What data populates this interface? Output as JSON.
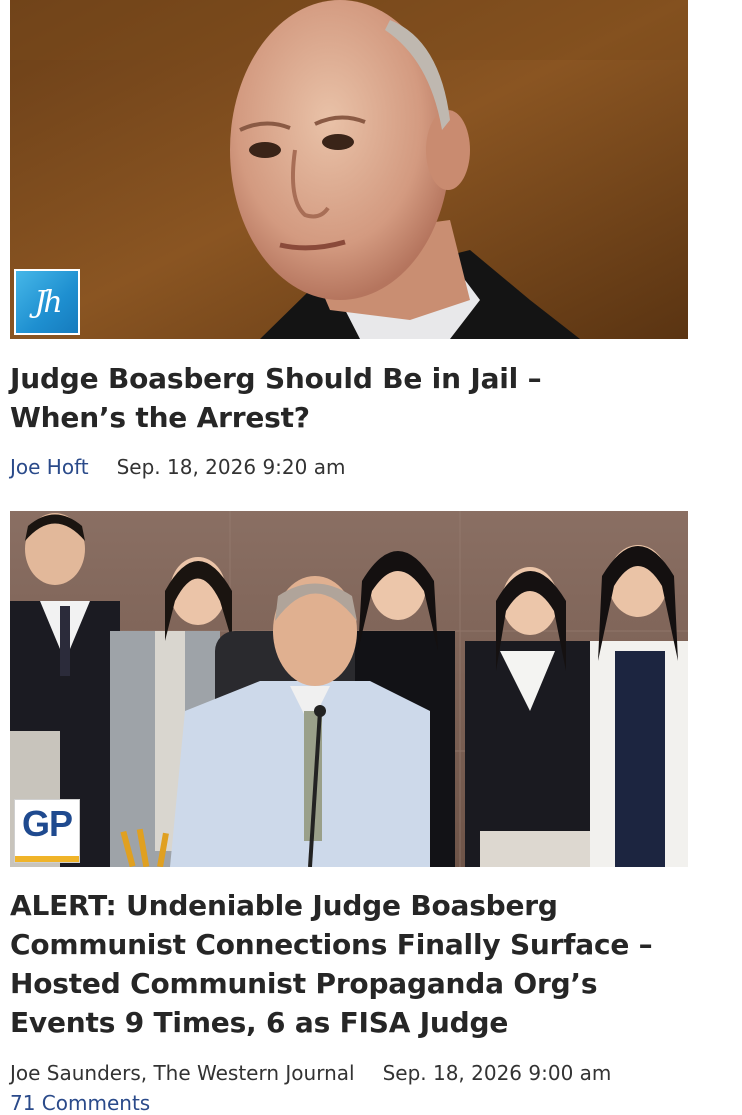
{
  "articles": [
    {
      "badge": {
        "text": "Jh",
        "icon": "thegatewaypundit-jh-logo",
        "color": "#1e8fd0"
      },
      "headline": "Judge Boasberg Should Be in Jail – When’s the Arrest?",
      "author": "Joe Hoft",
      "date": "Sep. 18, 2026 9:20 am"
    },
    {
      "badge": {
        "text": "GP",
        "icon": "gateway-pundit-gp-logo",
        "color": "#1f4a8f",
        "accent": "#f0b429"
      },
      "headline": "ALERT: Undeniable Judge Boasberg Communist Connections Finally Surface – Hosted Communist Propaganda Org’s Events 9 Times, 6 as FISA Judge",
      "author": "Joe Saunders, The Western Journal",
      "date": "Sep. 18, 2026 9:00 am",
      "comments": "71 Comments"
    }
  ],
  "colors": {
    "headline": "#262626",
    "link": "#2a4a8a",
    "meta": "#333333"
  }
}
